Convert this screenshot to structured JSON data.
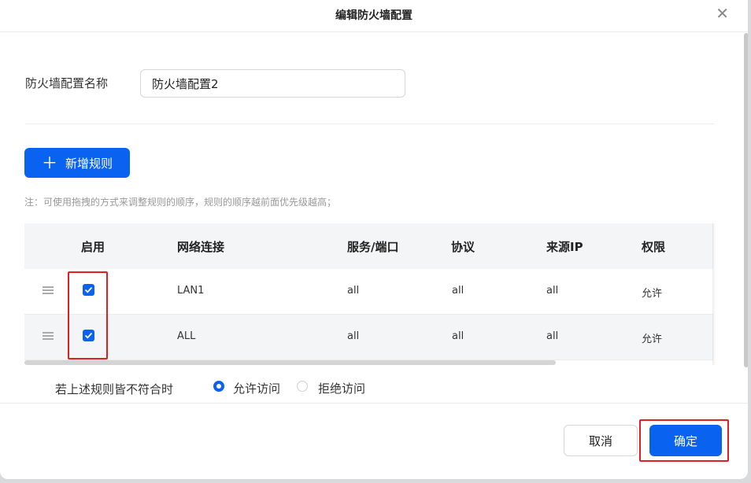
{
  "dialog": {
    "title": "编辑防火墙配置",
    "close_icon": "close-icon"
  },
  "form": {
    "name_label": "防火墙配置名称",
    "name_value": "防火墙配置2"
  },
  "toolbar": {
    "add_rule_label": "新增规则",
    "add_icon": "plus-icon"
  },
  "note": "注：可使用拖拽的方式来调整规则的顺序，规则的顺序越前面优先级越高；",
  "table": {
    "columns": [
      "启用",
      "网络连接",
      "服务/端口",
      "协议",
      "来源IP",
      "权限"
    ],
    "rows": [
      {
        "enabled": true,
        "connection": "LAN1",
        "service": "all",
        "protocol": "all",
        "source_ip": "all",
        "permission": "允许"
      },
      {
        "enabled": true,
        "connection": "ALL",
        "service": "all",
        "protocol": "all",
        "source_ip": "all",
        "permission": "允许"
      }
    ]
  },
  "default_policy": {
    "label": "若上述规则皆不符合时",
    "options": [
      {
        "label": "允许访问",
        "selected": true
      },
      {
        "label": "拒绝访问",
        "selected": false
      }
    ]
  },
  "footer": {
    "cancel_label": "取消",
    "confirm_label": "确定"
  },
  "colors": {
    "primary": "#0a63f0",
    "highlight": "#e02020"
  }
}
